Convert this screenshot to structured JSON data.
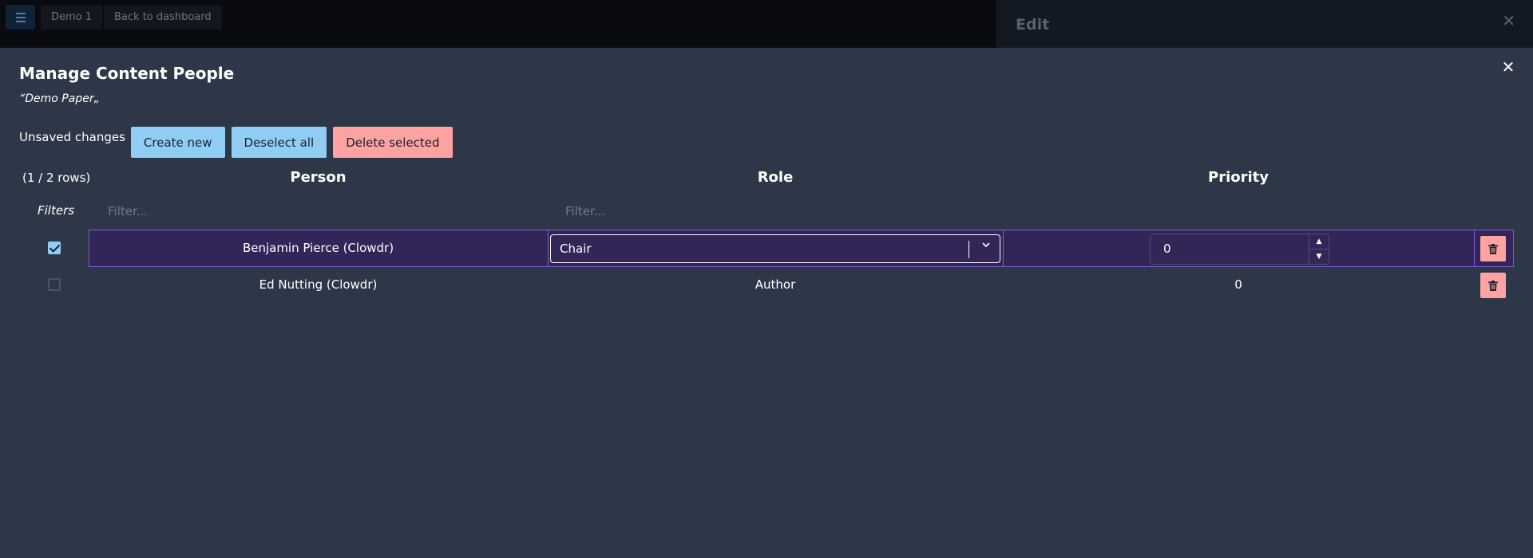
{
  "topbar": {
    "menu_icon": "hamburger-icon",
    "crumbs": [
      "Demo 1",
      "Back to dashboard"
    ]
  },
  "side_panel": {
    "title": "Edit",
    "close_icon": "close-icon"
  },
  "modal": {
    "title": "Manage Content People",
    "subtitle": "“Demo Paper„",
    "close_icon": "close-icon",
    "toolbar": {
      "status": "Unsaved changes",
      "create_label": "Create new",
      "deselect_label": "Deselect all",
      "delete_label": "Delete selected"
    },
    "table": {
      "row_count": "(1 / 2 rows)",
      "columns": [
        "Person",
        "Role",
        "Priority"
      ],
      "filters_label": "Filters",
      "filter_placeholder": "Filter...",
      "rows": [
        {
          "selected": true,
          "person": "Benjamin Pierce (Clowdr)",
          "role": "Chair",
          "priority": "0"
        },
        {
          "selected": false,
          "person": "Ed Nutting (Clowdr)",
          "role": "Author",
          "priority": "0"
        }
      ]
    }
  },
  "colors": {
    "background": "#2d3748",
    "accent_blue": "#90cdf4",
    "accent_red": "#fea2a2",
    "selected_row": "#322659",
    "selected_border": "#805ad5"
  }
}
